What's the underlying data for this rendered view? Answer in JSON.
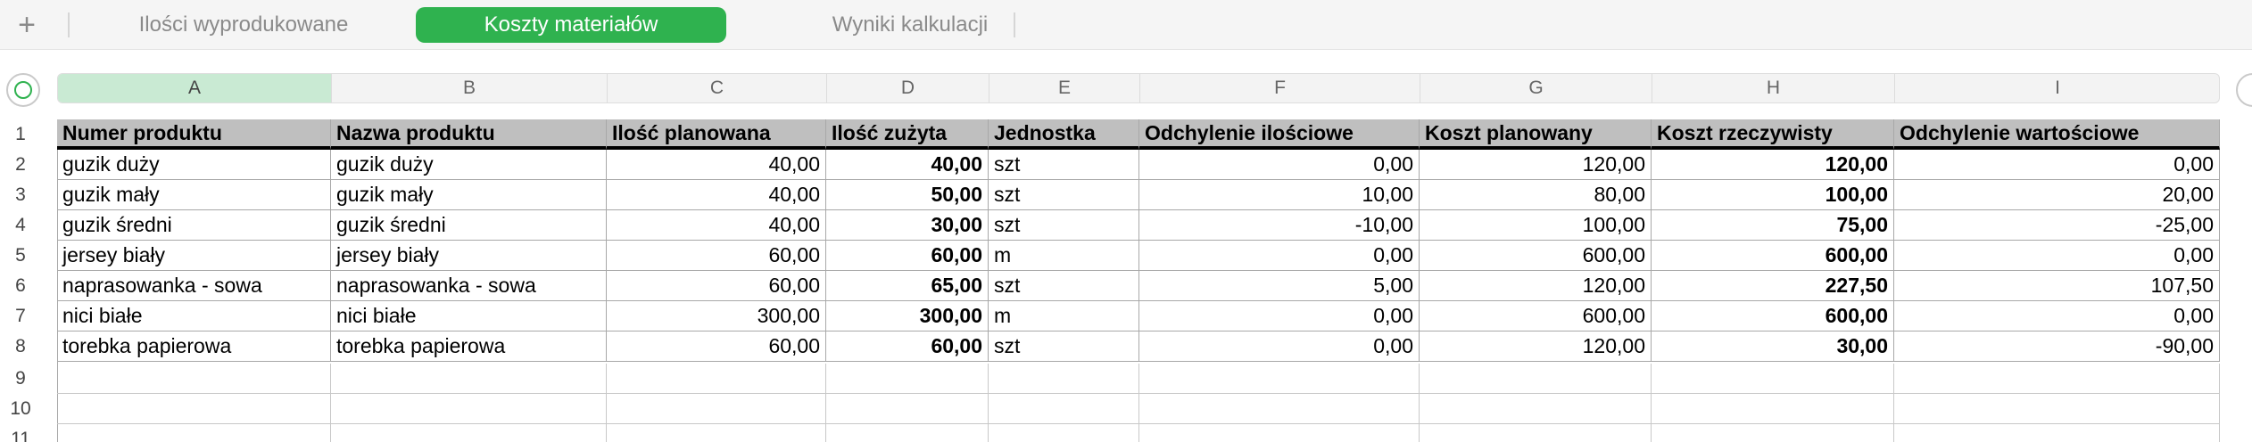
{
  "tabs": [
    {
      "label": "Ilości wyprodukowane",
      "active": false
    },
    {
      "label": "Koszty materiałów",
      "active": true
    },
    {
      "label": "Wyniki kalkulacji",
      "active": false
    }
  ],
  "add_sheet_icon": "plus-icon",
  "columns": [
    "A",
    "B",
    "C",
    "D",
    "E",
    "F",
    "G",
    "H",
    "I"
  ],
  "selected_column": "A",
  "row_numbers": [
    "1",
    "2",
    "3",
    "4",
    "5",
    "6",
    "7",
    "8",
    "9",
    "10",
    "11"
  ],
  "table": {
    "headers": [
      "Numer produktu",
      "Nazwa produktu",
      "Ilość planowana",
      "Ilość zużyta",
      "Jednostka",
      "Odchylenie ilościowe",
      "Koszt planowany",
      "Koszt rzeczywisty",
      "Odchylenie wartościowe"
    ],
    "rows": [
      [
        "guzik duży",
        "guzik duży",
        "40,00",
        "40,00",
        "szt",
        "0,00",
        "120,00",
        "120,00",
        "0,00"
      ],
      [
        "guzik mały",
        "guzik mały",
        "40,00",
        "50,00",
        "szt",
        "10,00",
        "80,00",
        "100,00",
        "20,00"
      ],
      [
        "guzik średni",
        "guzik średni",
        "40,00",
        "30,00",
        "szt",
        "-10,00",
        "100,00",
        "75,00",
        "-25,00"
      ],
      [
        "jersey biały",
        "jersey biały",
        "60,00",
        "60,00",
        "m",
        "0,00",
        "600,00",
        "600,00",
        "0,00"
      ],
      [
        "naprasowanka - sowa",
        "naprasowanka - sowa",
        "60,00",
        "65,00",
        "szt",
        "5,00",
        "120,00",
        "227,50",
        "107,50"
      ],
      [
        "nici białe",
        "nici białe",
        "300,00",
        "300,00",
        "m",
        "0,00",
        "600,00",
        "600,00",
        "0,00"
      ],
      [
        "torebka papierowa",
        "torebka papierowa",
        "60,00",
        "60,00",
        "szt",
        "0,00",
        "120,00",
        "30,00",
        "-90,00"
      ]
    ]
  },
  "colors": {
    "accent": "#2fb24f",
    "header_fill": "#bfbfbf",
    "selected_column": "#c9ead3"
  }
}
